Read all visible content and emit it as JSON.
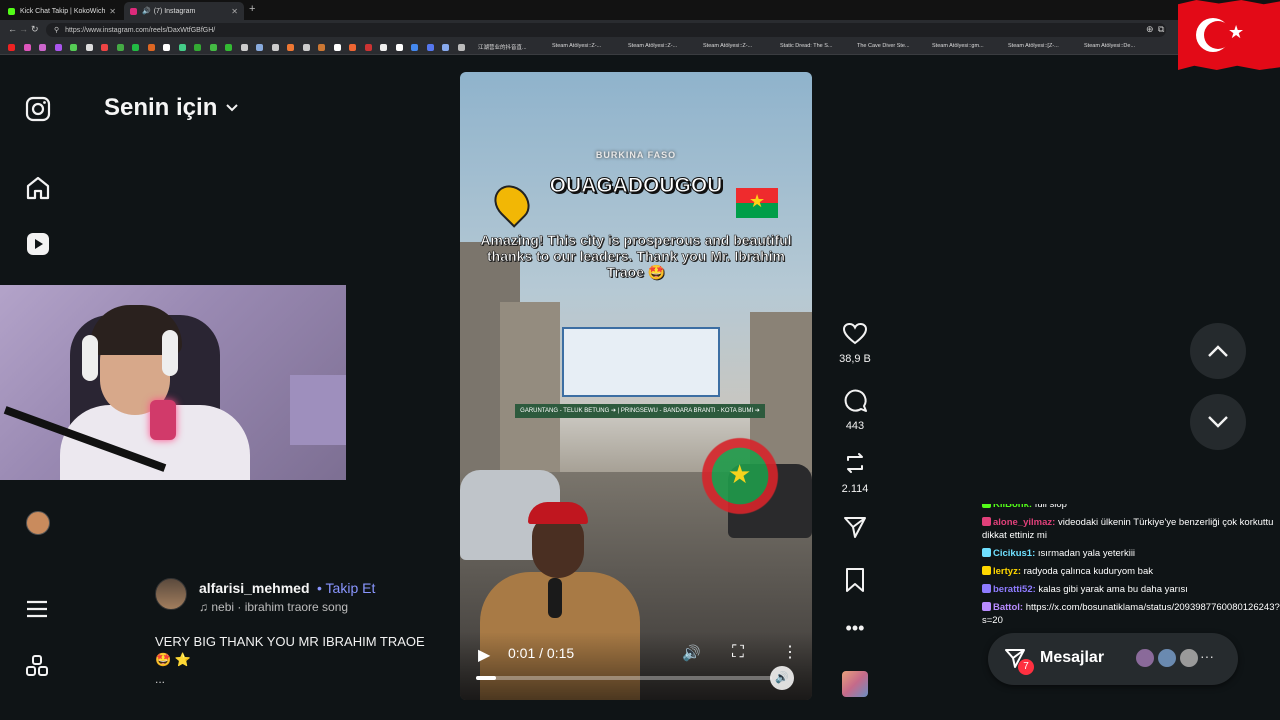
{
  "browser": {
    "tabs": [
      {
        "title": "Kick Chat Takip | KokoWich",
        "favicon_color": "#53fc18"
      },
      {
        "title": "(7) Instagram",
        "favicon_color": "#dd2a7b"
      }
    ],
    "new_tab_icon": "plus-icon",
    "url": "https://www.instagram.com/reels/DaxWtfGBfGH/",
    "bookmark_titles": [
      "江湖营业的抖音直...",
      "Steam Atölyesi::Z-...",
      "Steam Atölyesi::Z-...",
      "Steam Atölyesi::Z-...",
      "Static Dread: The S...",
      "The Cave Diver Ste...",
      "Steam Atölyesi::gm...",
      "Steam Atölyesi::[Z-...",
      "Steam Atölyesi::De..."
    ],
    "bookmark_colors": [
      "#e22",
      "#d5b",
      "#c6c",
      "#a5e",
      "#5c5",
      "#ddd",
      "#e44",
      "#4a4",
      "#2b4",
      "#d62",
      "#fff",
      "#4c8",
      "#3a3",
      "#4b4",
      "#3b3",
      "#ccc",
      "#8ad",
      "#ccc",
      "#e73",
      "#ccc",
      "#c73",
      "#fff",
      "#e63",
      "#c33",
      "#eee",
      "#fff",
      "#48e",
      "#57e",
      "#8ae",
      "#bbb"
    ]
  },
  "overlay_flag": "turkey-flag",
  "sidebar": {
    "brand_icon": "instagram-logo-icon",
    "items": [
      {
        "name": "home",
        "icon": "home-icon"
      },
      {
        "name": "reels",
        "icon": "reels-icon"
      },
      {
        "name": "profile",
        "icon": "avatar"
      },
      {
        "name": "more",
        "icon": "menu-icon"
      },
      {
        "name": "also-from-meta",
        "icon": "grid-icon"
      }
    ]
  },
  "feed": {
    "title": "Senin için",
    "title_icon": "chevron-down-icon"
  },
  "video": {
    "overlay_subtitle": "BURKINA FASO",
    "overlay_title": "OUAGADOUGOU",
    "overlay_caption": "Amazing! This city is prosperous and beautiful thanks to our leaders. Thank you Mr. Ibrahim Traoe 🤩",
    "gate_text": "GARUNTANG - TELUK BETUNG ➔ | PRINGSEWU - BANDARA BRANTI - KOTA BUMI ➔",
    "controls": {
      "time": "0:01 / 0:15",
      "progress": 0.0667
    }
  },
  "actions": [
    {
      "name": "like",
      "icon": "heart-icon",
      "count": "38,9 B"
    },
    {
      "name": "comment",
      "icon": "comment-icon",
      "count": "443"
    },
    {
      "name": "repost",
      "icon": "repost-icon",
      "count": "2.114"
    },
    {
      "name": "share",
      "icon": "send-icon",
      "count": ""
    },
    {
      "name": "save",
      "icon": "bookmark-icon",
      "count": ""
    },
    {
      "name": "more",
      "icon": "more-horizontal-icon",
      "count": ""
    }
  ],
  "post": {
    "author": "alfarisi_mehmed",
    "follow_label": "Takip Et",
    "song": "nebi · ibrahim traore song",
    "caption": "VERY BIG THANK YOU MR IBRAHIM TRAOE 🤩 ⭐",
    "caption_more": "..."
  },
  "chat": {
    "messages": [
      {
        "user": "KiiBonk:",
        "text": "full slop",
        "color": "#53fc18"
      },
      {
        "user": "alone_yilmaz:",
        "text": "videodaki ülkenin Türkiye'ye benzerliği çok korkuttu dikkat ettiniz mi",
        "color": "#e0407a"
      },
      {
        "user": "Cicikus1:",
        "text": "ısırmadan yala yeterkiii",
        "color": "#6fe0ff"
      },
      {
        "user": "lertyz:",
        "text": "radyoda çalınca kuduryom bak",
        "color": "#ffd700"
      },
      {
        "user": "beratti52:",
        "text": "kalas gibi yarak ama bu daha yarısı",
        "color": "#8e7bff"
      },
      {
        "user": "Battol:",
        "text": "https://x.com/bosunatiklama/status/2093987760080126243?s=20",
        "color": "#b98cff"
      }
    ]
  },
  "messages_pill": {
    "label": "Mesajlar",
    "badge": "7",
    "icon": "message-icon"
  }
}
